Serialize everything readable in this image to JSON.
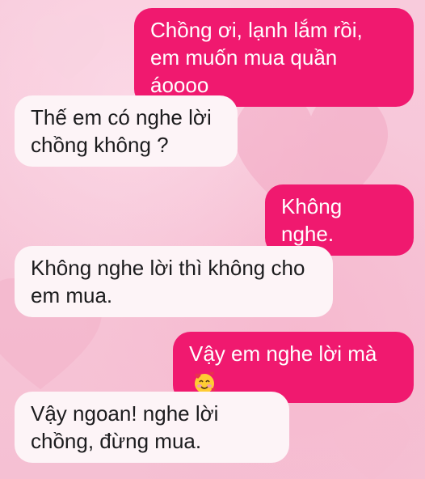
{
  "chat": {
    "messages": [
      {
        "sender": "me",
        "text": "Chồng ơi, lạnh lắm rồi, em muốn mua quần áoooo"
      },
      {
        "sender": "other",
        "text": "Thế em có nghe lời chồng không ?"
      },
      {
        "sender": "me",
        "text": "Không nghe."
      },
      {
        "sender": "other",
        "text": "Không nghe lời thì không cho em mua."
      },
      {
        "sender": "me",
        "text": "Vậy em nghe lời mà",
        "emoji": "smiling-face-with-hearts"
      },
      {
        "sender": "other",
        "text": "Vậy ngoan! nghe lời chồng, đừng mua."
      }
    ]
  },
  "colors": {
    "sent_bubble": "#f0196f",
    "received_bubble": "#fdf4f7",
    "background": "#f7c6d9"
  }
}
